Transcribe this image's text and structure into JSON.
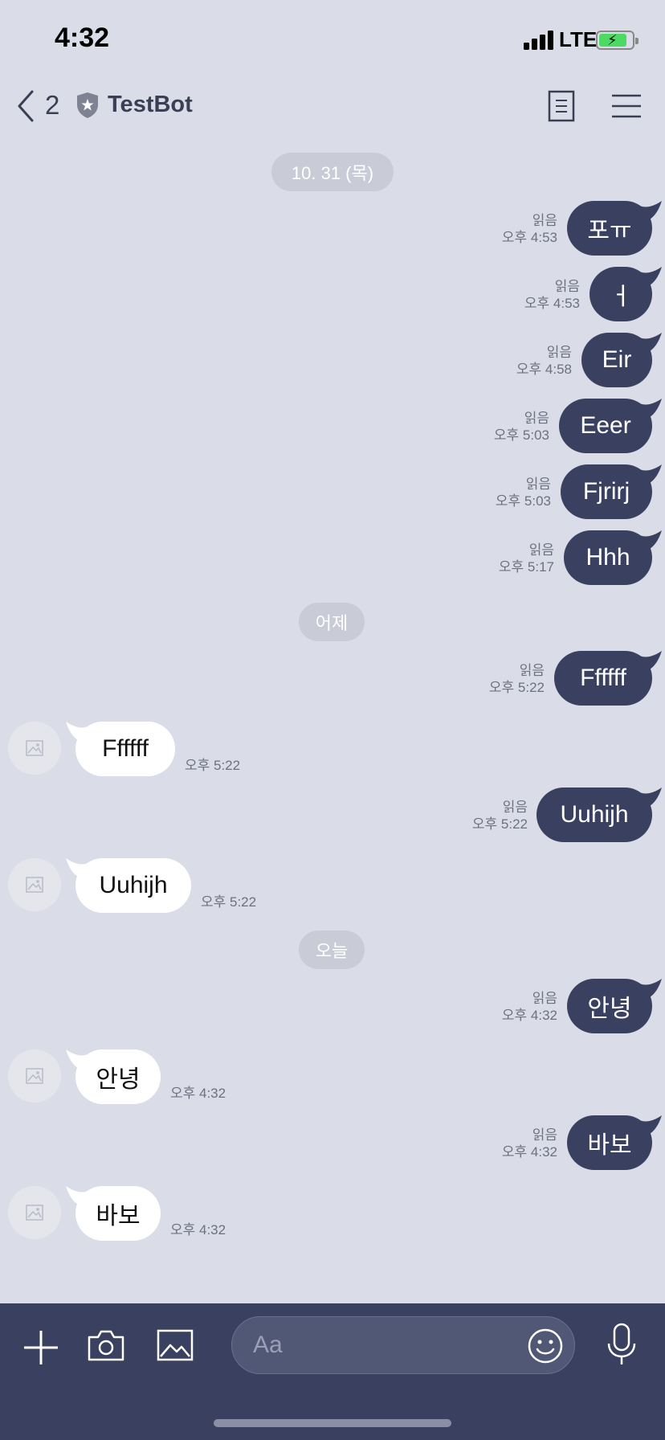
{
  "status_bar": {
    "time": "4:32",
    "network": "LTE",
    "battery_color": "#4cd964"
  },
  "header": {
    "back_count": "2",
    "title": "TestBot",
    "icons": [
      "back-chevron-icon",
      "shield-star-icon",
      "notes-icon",
      "menu-icon"
    ]
  },
  "dates": {
    "d1": "10. 31 (목)",
    "d2": "어제",
    "d3": "오늘"
  },
  "messages": {
    "m1": {
      "direction": "out",
      "text": "포ㅠ",
      "read": "읽음",
      "time": "오후 4:53"
    },
    "m2": {
      "direction": "out",
      "text": "ㅓ",
      "read": "읽음",
      "time": "오후 4:53"
    },
    "m3": {
      "direction": "out",
      "text": "Eir",
      "read": "읽음",
      "time": "오후 4:58"
    },
    "m4": {
      "direction": "out",
      "text": "Eeer",
      "read": "읽음",
      "time": "오후 5:03"
    },
    "m5": {
      "direction": "out",
      "text": "Fjrirj",
      "read": "읽음",
      "time": "오후 5:03"
    },
    "m6": {
      "direction": "out",
      "text": "Hhh",
      "read": "읽음",
      "time": "오후 5:17"
    },
    "m7": {
      "direction": "out",
      "text": "Ffffff",
      "read": "읽음",
      "time": "오후 5:22"
    },
    "m8": {
      "direction": "in",
      "text": "Ffffff",
      "time": "오후 5:22"
    },
    "m9": {
      "direction": "out",
      "text": "Uuhijh",
      "read": "읽음",
      "time": "오후 5:22"
    },
    "m10": {
      "direction": "in",
      "text": "Uuhijh",
      "time": "오후 5:22"
    },
    "m11": {
      "direction": "out",
      "text": "안녕",
      "read": "읽음",
      "time": "오후 4:32"
    },
    "m12": {
      "direction": "in",
      "text": "안녕",
      "time": "오후 4:32"
    },
    "m13": {
      "direction": "out",
      "text": "바보",
      "read": "읽음",
      "time": "오후 4:32"
    },
    "m14": {
      "direction": "in",
      "text": "바보",
      "time": "오후 4:32"
    }
  },
  "input_bar": {
    "placeholder": "Aa",
    "value": "",
    "icons": [
      "plus-icon",
      "camera-icon",
      "image-icon",
      "emoji-icon",
      "microphone-icon"
    ]
  },
  "colors": {
    "background": "#dadde7",
    "outgoing_bubble": "#3a4160",
    "incoming_bubble": "#ffffff",
    "bottom_bar": "#3a4160"
  }
}
